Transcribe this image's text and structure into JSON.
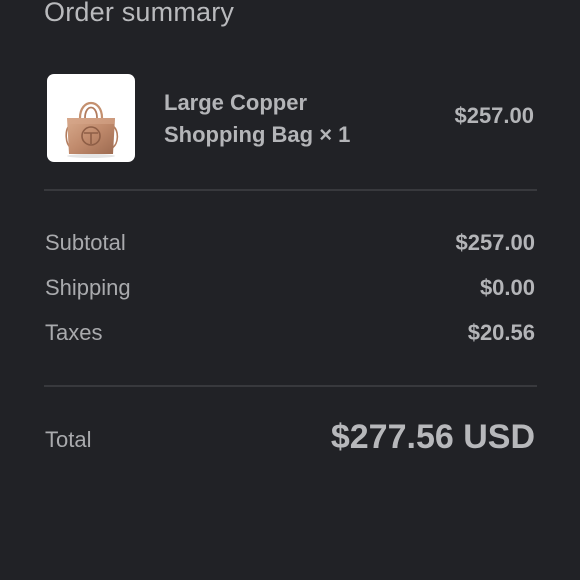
{
  "header": {
    "title": "Order summary"
  },
  "item": {
    "name": "Large Copper Shopping Bag × 1",
    "price": "$257.00",
    "image_icon": "copper-tote-bag"
  },
  "summary": {
    "subtotal_label": "Subtotal",
    "subtotal_value": "$257.00",
    "shipping_label": "Shipping",
    "shipping_value": "$0.00",
    "taxes_label": "Taxes",
    "taxes_value": "$20.56"
  },
  "total": {
    "label": "Total",
    "value": "$277.56 USD"
  },
  "colors": {
    "background": "#212226",
    "text": "#b4b5b8",
    "divider": "#38393d",
    "product_bronze": "#c08a6c"
  }
}
